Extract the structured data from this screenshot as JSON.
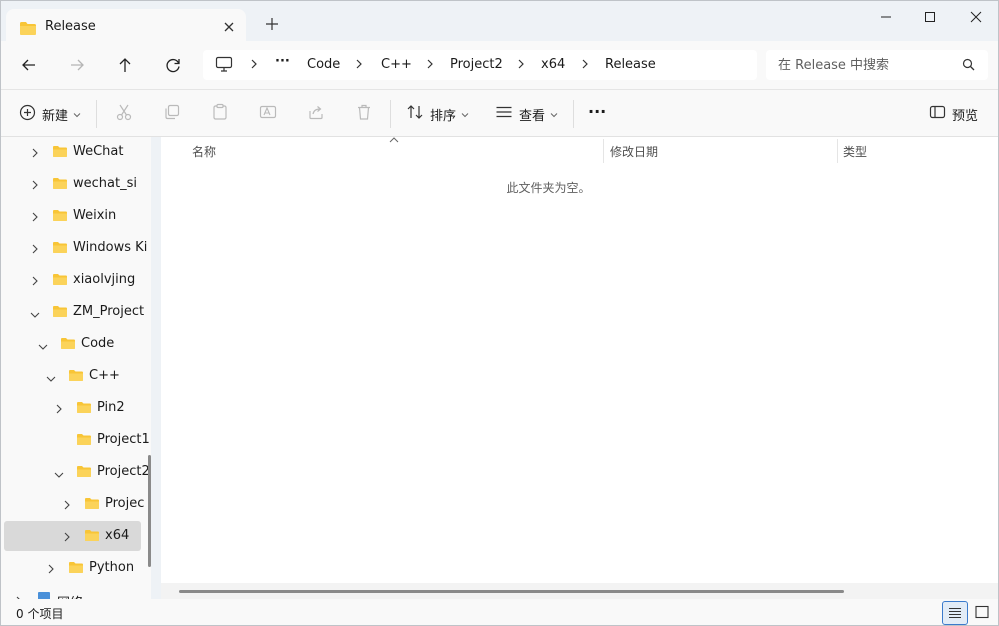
{
  "window": {
    "tab_title": "Release",
    "new_tab_symbol": "+"
  },
  "breadcrumb": {
    "overflow": "···",
    "items": [
      "Code",
      "C++",
      "Project2",
      "x64",
      "Release"
    ]
  },
  "search": {
    "placeholder": "在 Release 中搜索"
  },
  "commands": {
    "new_label": "新建",
    "sort_label": "排序",
    "view_label": "查看",
    "more_label": "···",
    "preview_label": "预览"
  },
  "sidebar": {
    "items": [
      {
        "label": "WeChat"
      },
      {
        "label": "wechat_si"
      },
      {
        "label": "Weixin"
      },
      {
        "label": "Windows Ki"
      },
      {
        "label": "xiaolvjing"
      },
      {
        "label": "ZM_Project"
      },
      {
        "label": "Code"
      },
      {
        "label": "C++"
      },
      {
        "label": "Pin2"
      },
      {
        "label": "Project1"
      },
      {
        "label": "Project2"
      },
      {
        "label": "Projec"
      },
      {
        "label": "x64"
      },
      {
        "label": "Python"
      },
      {
        "label": "网络"
      }
    ]
  },
  "columns": {
    "name": "名称",
    "modified": "修改日期",
    "type": "类型"
  },
  "content": {
    "empty_message": "此文件夹为空。"
  },
  "status": {
    "item_count": "0 个项目"
  },
  "colors": {
    "folder": "#f8c537",
    "accent": "#3b7bcc"
  }
}
